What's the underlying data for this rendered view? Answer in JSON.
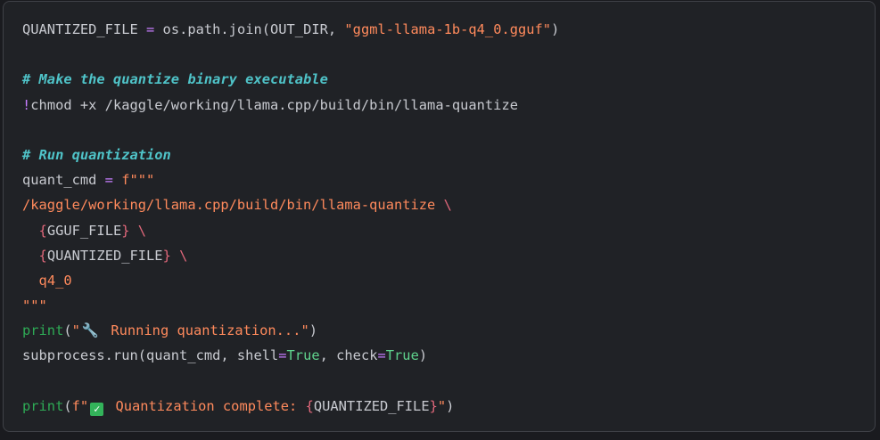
{
  "code": {
    "line1": {
      "var": "QUANTIZED_FILE ",
      "eq": "=",
      "mid": " os.path.join(OUT_DIR, ",
      "str": "\"ggml-llama-1b-q4_0.gguf\"",
      "end": ")"
    },
    "comment1": "# Make the quantize binary executable",
    "line2": {
      "bang": "!",
      "cmd": "chmod +x /kaggle/working/llama.cpp/build/bin/llama-quantize"
    },
    "comment2": "# Run quantization",
    "line3": {
      "var": "quant_cmd ",
      "eq": "=",
      "prefix": " f",
      "str": "\"\"\""
    },
    "line4": {
      "str": "/kaggle/working/llama.cpp/build/bin/llama-quantize ",
      "backslash": "\\"
    },
    "line5": {
      "indent": "  ",
      "open": "{",
      "name": "GGUF_FILE",
      "close": "}",
      "backslash": " \\"
    },
    "line6": {
      "indent": "  ",
      "open": "{",
      "name": "QUANTIZED_FILE",
      "close": "}",
      "backslash": " \\"
    },
    "line7": {
      "indent": "  ",
      "str": "q4_0"
    },
    "line8": {
      "str": "\"\"\""
    },
    "line9": {
      "func": "print",
      "open": "(",
      "quote": "\"",
      "icon": "wrench-icon",
      "str": " Running quantization...\"",
      "close": ")"
    },
    "line10": {
      "pre": "subprocess.run(quant_cmd, shell",
      "eq1": "=",
      "true1": "True",
      "mid": ", check",
      "eq2": "=",
      "true2": "True",
      "close": ")"
    },
    "line11": {
      "func": "print",
      "open": "(",
      "prefix": "f",
      "quote": "\"",
      "icon": "check-icon",
      "str": " Quantization complete: ",
      "brace_open": "{",
      "name": "QUANTIZED_FILE",
      "brace_close": "}",
      "str_end": "\"",
      "close": ")"
    }
  },
  "icons": {
    "wrench": "🔧",
    "check": "✓"
  },
  "colors": {
    "background": "#202226",
    "plain": "#c8cad0",
    "operator": "#c77dff",
    "string": "#ff8a5c",
    "comment": "#4fc3c8",
    "function": "#2eaa55",
    "constant": "#5fd38d",
    "brace": "#e2687b"
  }
}
